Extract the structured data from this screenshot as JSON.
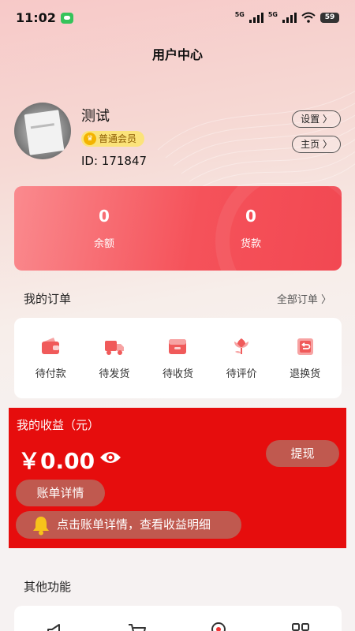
{
  "status_bar": {
    "time": "11:02",
    "network_1": "5G",
    "network_2": "5G",
    "battery": "59"
  },
  "header": {
    "title": "用户中心"
  },
  "profile": {
    "name": "测试",
    "member_level": "普通会员",
    "user_id": "ID: 171847",
    "settings_label": "设置 〉",
    "home_label": "主页 〉"
  },
  "balance_card": {
    "balance_value": "0",
    "balance_label": "余额",
    "payment_value": "0",
    "payment_label": "货款"
  },
  "orders": {
    "title": "我的订单",
    "all_orders_label": "全部订单 〉",
    "items": [
      {
        "label": "待付款",
        "icon": "wallet-icon"
      },
      {
        "label": "待发货",
        "icon": "truck-icon"
      },
      {
        "label": "待收货",
        "icon": "box-icon"
      },
      {
        "label": "待评价",
        "icon": "flower-icon"
      },
      {
        "label": "退换货",
        "icon": "return-icon"
      }
    ]
  },
  "earnings": {
    "title": "我的收益（元）",
    "amount": "￥0.00",
    "withdraw_label": "提现",
    "bill_details_label": "账单详情",
    "notice_text": "点击账单详情，查看收益明细"
  },
  "other_functions": {
    "title": "其他功能",
    "icons": [
      "megaphone-icon",
      "cart-icon",
      "location-icon",
      "grid-icon"
    ]
  },
  "colors": {
    "accent_red": "#e60d0d",
    "card_red": "#f5525a",
    "order_icon_red": "#f05a5a",
    "badge_yellow": "#fbe37a"
  }
}
